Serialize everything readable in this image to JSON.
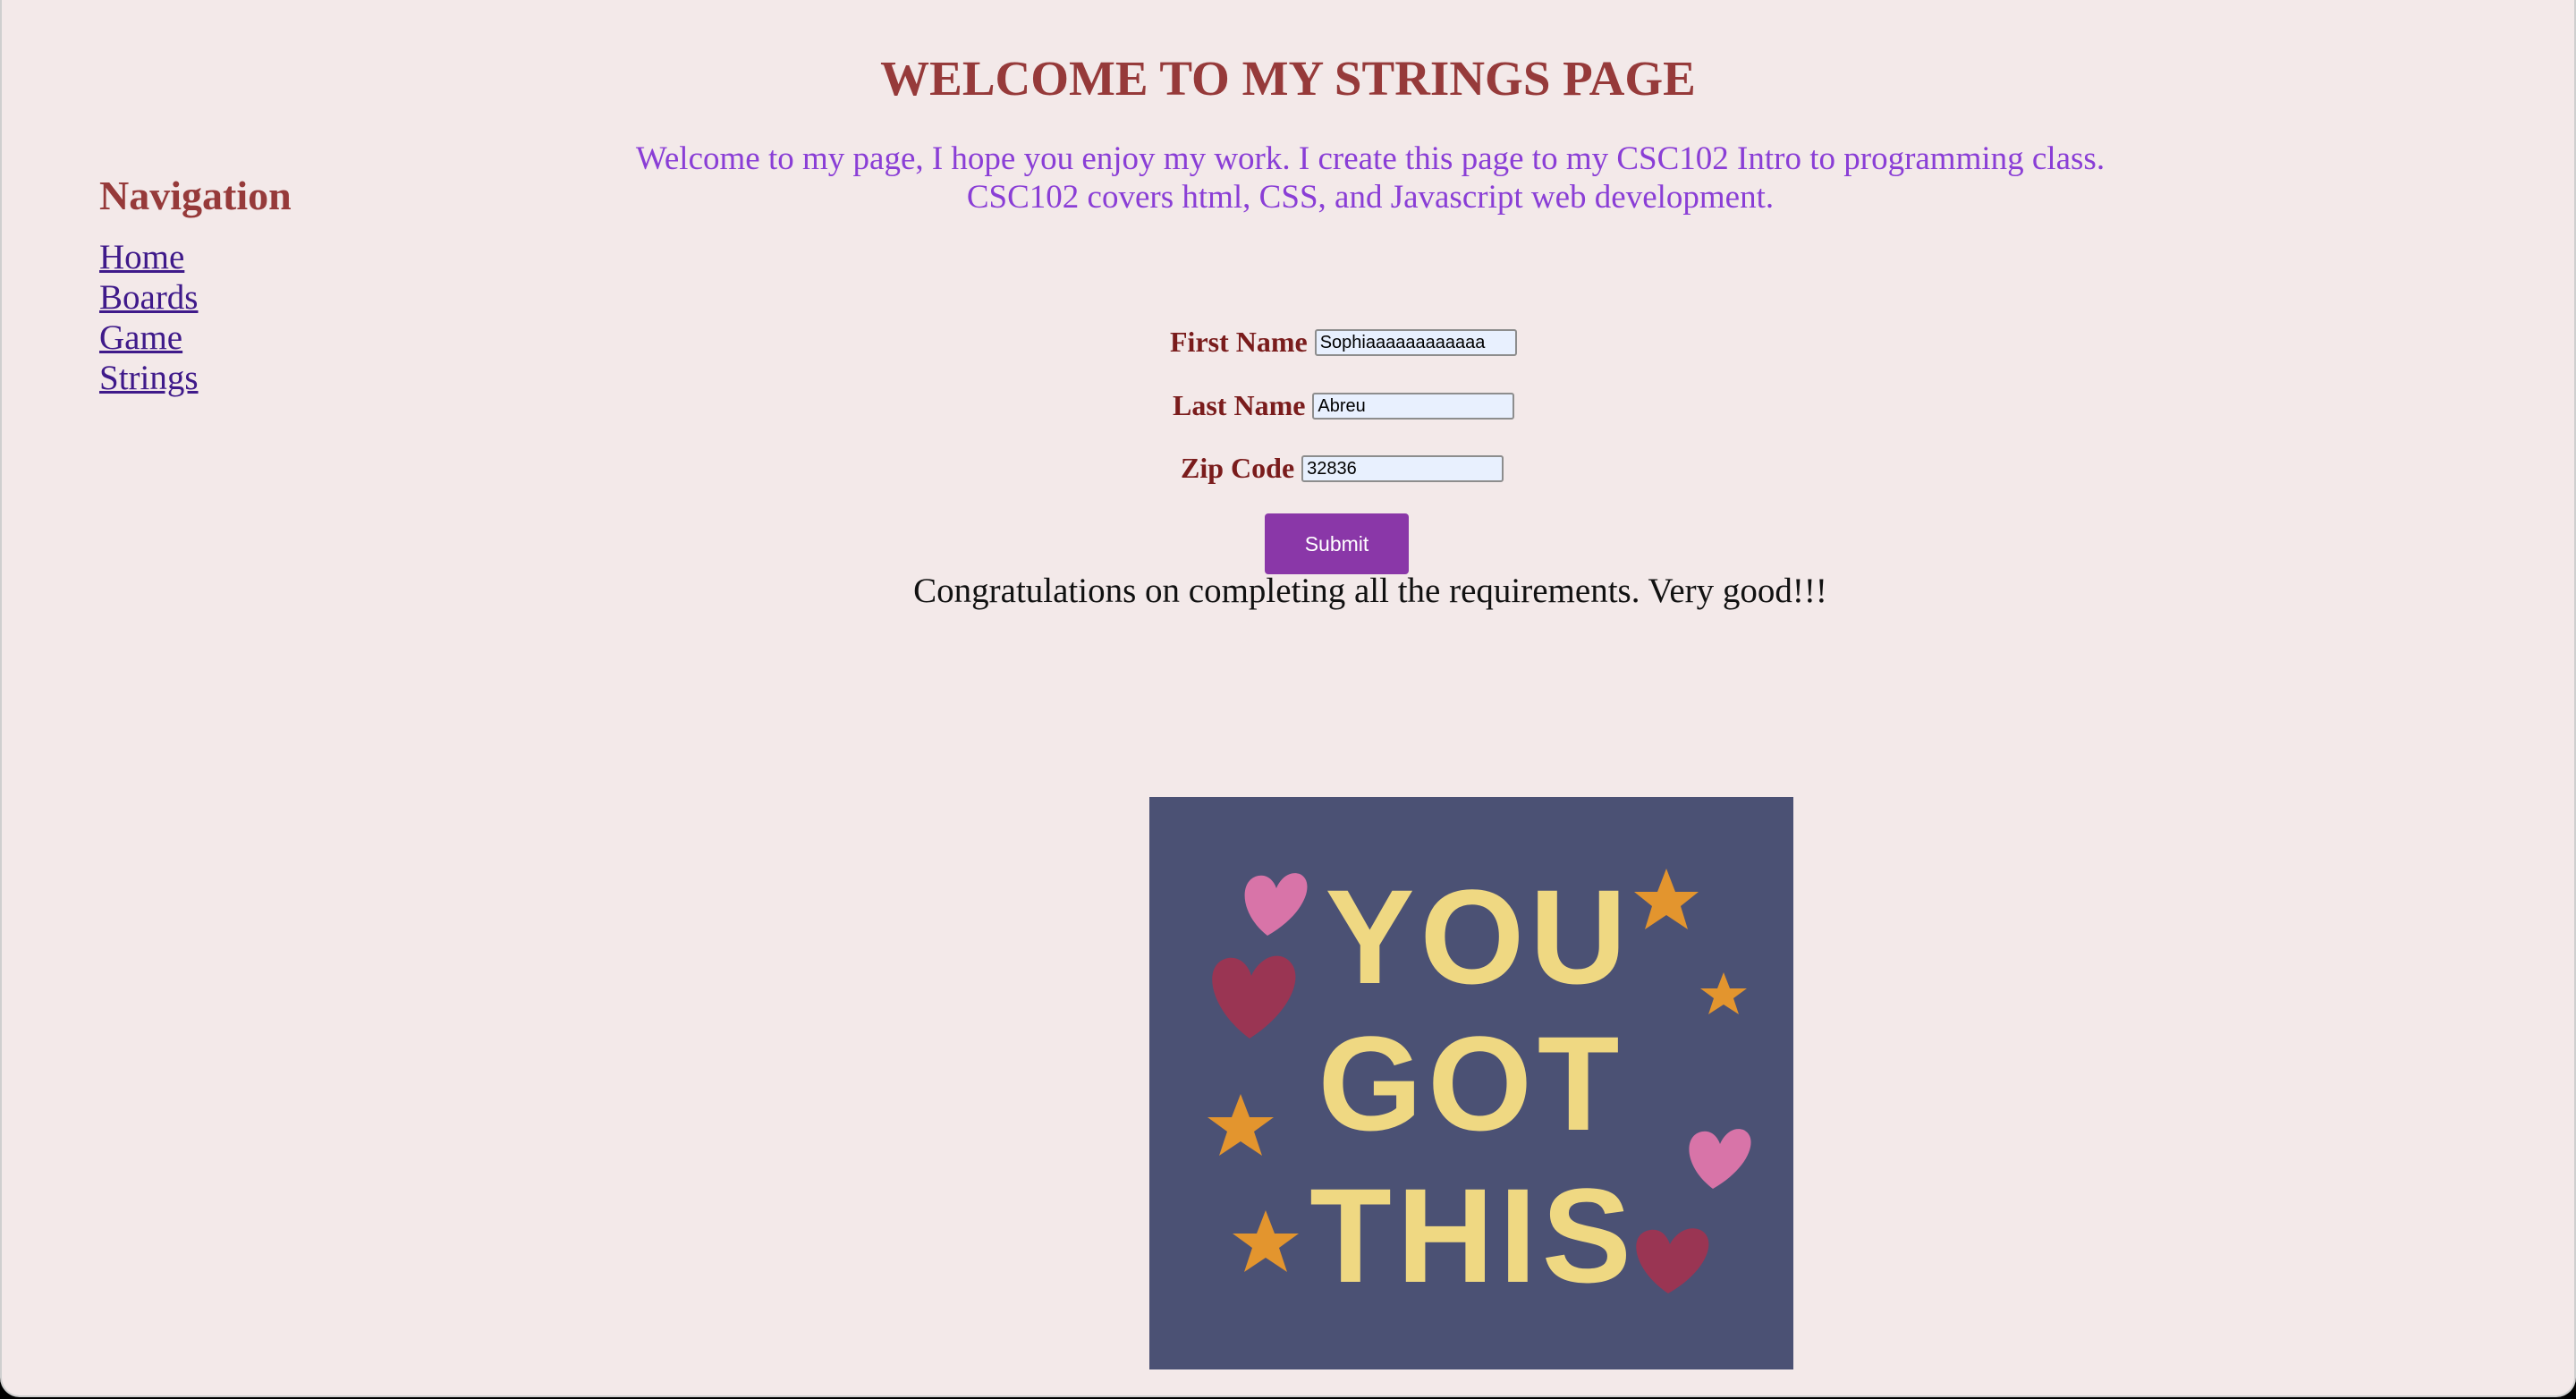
{
  "page": {
    "title": "WELCOME TO MY STRINGS PAGE",
    "intro_line1": "Welcome to my page, I hope you enjoy my work. I create this page to my CSC102 Intro to programming class.",
    "intro_line2": "CSC102 covers html, CSS, and Javascript web development."
  },
  "nav": {
    "heading": "Navigation",
    "items": [
      {
        "label": "Home"
      },
      {
        "label": "Boards"
      },
      {
        "label": "Game"
      },
      {
        "label": "Strings"
      }
    ]
  },
  "form": {
    "first_name": {
      "label": "First Name",
      "value": "Sophiaaaaaaaaaaaa"
    },
    "last_name": {
      "label": "Last Name",
      "value": "Abreu"
    },
    "zip_code": {
      "label": "Zip Code",
      "value": "32836"
    },
    "submit_label": "Submit"
  },
  "message": "Congratulations on completing all the requirements. Very good!!!",
  "image": {
    "lines": [
      "YOU",
      "GOT",
      "THIS"
    ],
    "colors": {
      "background": "#4b5174",
      "letters": "#efd882",
      "stars": "#e3952e",
      "heart_pink": "#d874a8",
      "heart_red": "#9a3553"
    }
  },
  "colors": {
    "page_bg": "#f3e9e9",
    "title": "#963a3a",
    "intro": "#8a3ed6",
    "link": "#3f1a8a",
    "label": "#7a1c1c",
    "submit_bg": "#8a37a8"
  }
}
